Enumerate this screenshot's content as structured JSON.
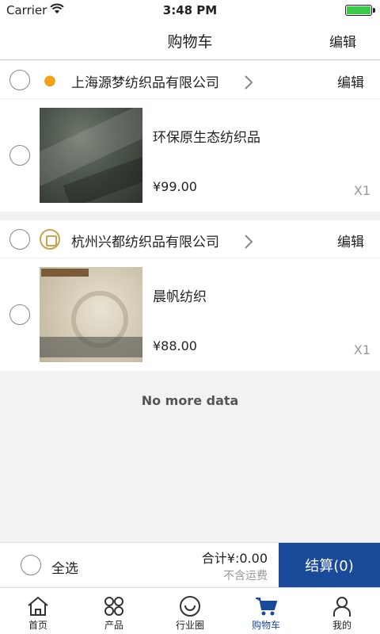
{
  "status_bar": {
    "carrier": "Carrier",
    "time": "3:48 PM"
  },
  "nav": {
    "title": "购物车",
    "edit_label": "编辑"
  },
  "shops": [
    {
      "name": "上海源梦纺织品有限公司",
      "edit_label": "编辑",
      "items": [
        {
          "name": "环保原生态纺织品",
          "price": "¥99.00",
          "qty": "X1"
        }
      ]
    },
    {
      "name": "杭州兴都纺织品有限公司",
      "edit_label": "编辑",
      "items": [
        {
          "name": "晨帆纺织",
          "price": "¥88.00",
          "qty": "X1"
        }
      ]
    }
  ],
  "list_footer": {
    "no_more": "No more data"
  },
  "checkout": {
    "select_all": "全选",
    "total": "合计¥:0.00",
    "shipping_note": "不含运费",
    "button": "结算(0)"
  },
  "tabs": [
    {
      "label": "首页",
      "icon": "home-icon"
    },
    {
      "label": "产品",
      "icon": "grid-icon"
    },
    {
      "label": "行业圈",
      "icon": "smile-icon"
    },
    {
      "label": "购物车",
      "icon": "cart-icon",
      "active": true
    },
    {
      "label": "我的",
      "icon": "user-icon"
    }
  ],
  "colors": {
    "accent": "#1a4a9a",
    "battery": "#3bc94a"
  }
}
